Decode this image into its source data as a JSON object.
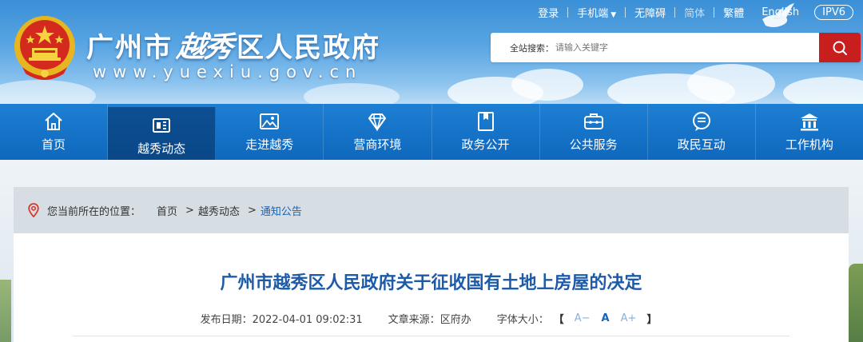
{
  "header": {
    "title_prefix": "广州市",
    "title_calligraphy": "越秀",
    "title_suffix": "区人民政府",
    "url": "www.yuexiu.gov.cn",
    "top_links": {
      "login": "登录",
      "mobile": "手机端",
      "accessibility": "无障碍",
      "simplified": "简体",
      "traditional": "繁體",
      "english": "English",
      "ipv6": "IPV6"
    },
    "search": {
      "label": "全站搜索：",
      "placeholder": "请输入关键字"
    }
  },
  "nav": {
    "items": [
      {
        "label": "首页",
        "icon": "home-icon"
      },
      {
        "label": "越秀动态",
        "icon": "news-icon",
        "active": true
      },
      {
        "label": "走进越秀",
        "icon": "picture-icon"
      },
      {
        "label": "营商环境",
        "icon": "diamond-icon"
      },
      {
        "label": "政务公开",
        "icon": "bookmark-icon"
      },
      {
        "label": "公共服务",
        "icon": "toolbox-icon"
      },
      {
        "label": "政民互动",
        "icon": "chat-icon"
      },
      {
        "label": "工作机构",
        "icon": "building-icon"
      }
    ]
  },
  "breadcrumb": {
    "label": "您当前所在的位置：",
    "items": [
      "首页",
      "越秀动态",
      "通知公告"
    ]
  },
  "article": {
    "title": "广州市越秀区人民政府关于征收国有土地上房屋的决定",
    "date_label": "发布日期：",
    "date": "2022-04-01 09:02:31",
    "source_label": "文章来源：",
    "source": "区府办",
    "font_label": "字体大小：",
    "font_small": "A−",
    "font_medium": "A",
    "font_large": "A+",
    "bracket_open": "【",
    "bracket_close": "】"
  },
  "colors": {
    "nav_blue": "#1570c8",
    "nav_active": "#0c4f93",
    "search_button": "#c81e1e",
    "title_blue": "#1d5aa8"
  }
}
